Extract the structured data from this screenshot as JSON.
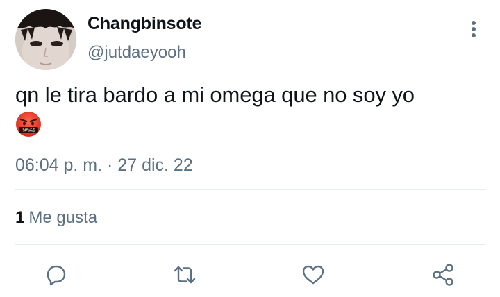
{
  "tweet": {
    "author": {
      "display_name": "Changbinsote",
      "handle": "@jutdaeyooh"
    },
    "text": "qn le tira bardo a mi omega que no soy yo",
    "emoji": "face-with-symbols-on-mouth",
    "time": "06:04 p. m.",
    "separator": "·",
    "date": "27 dic. 22",
    "likes": {
      "count": "1",
      "label": "Me gusta"
    }
  },
  "actions": [
    {
      "name": "reply",
      "icon": "reply-icon"
    },
    {
      "name": "retweet",
      "icon": "retweet-icon"
    },
    {
      "name": "like",
      "icon": "heart-icon"
    },
    {
      "name": "share",
      "icon": "share-icon"
    }
  ],
  "colors": {
    "text_primary": "#0f1419",
    "text_secondary": "#5b7083",
    "icon": "#5b7083",
    "divider": "#e6ecf0"
  }
}
